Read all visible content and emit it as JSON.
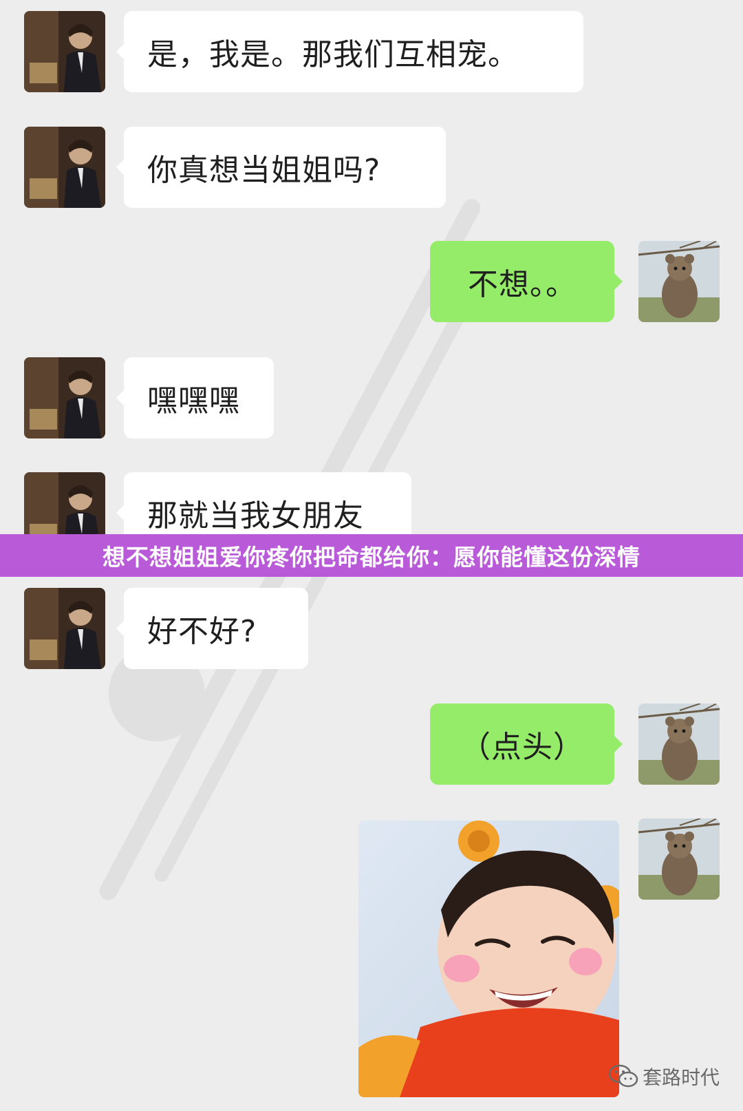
{
  "messages": [
    {
      "side": "left",
      "text": "是，我是。那我们互相宠。"
    },
    {
      "side": "left",
      "text": "你真想当姐姐吗?"
    },
    {
      "side": "right",
      "text": "不想。。"
    },
    {
      "side": "left",
      "text": "嘿嘿嘿"
    },
    {
      "side": "left",
      "text": "那就当我女朋友"
    },
    {
      "side": "left",
      "text": "好不好?"
    },
    {
      "side": "right",
      "text": "（点头）"
    }
  ],
  "banner": {
    "text": "想不想姐姐爱你疼你把命都给你：愿你能懂这份深情"
  },
  "signature": {
    "text": "套路时代"
  },
  "colors": {
    "background": "#ededed",
    "incoming_bubble": "#ffffff",
    "outgoing_bubble": "#95ec69",
    "banner": "#b95bd8"
  },
  "icons": {
    "left_avatar": "man-photo-avatar",
    "right_avatar": "quokka-photo-avatar",
    "sticker": "laughing-baby-pooh-sticker",
    "signature_icon": "wechat-icon"
  }
}
